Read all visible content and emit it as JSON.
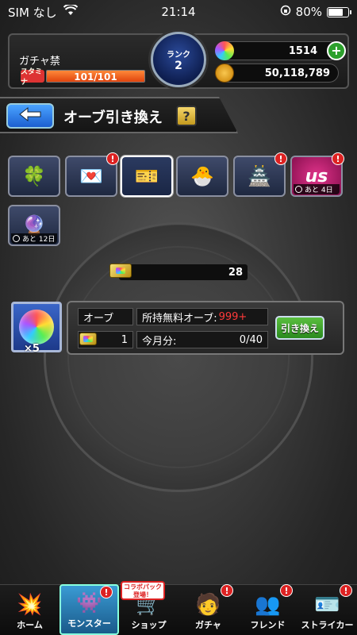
{
  "status_bar": {
    "carrier": "SIM なし",
    "time": "21:14",
    "battery": "80%",
    "battery_level": 0.8
  },
  "header": {
    "gacha_label": "ガチャ禁",
    "stamina_label": "スタミナ",
    "stamina_text": "101/101",
    "stamina_fraction": 1.0,
    "rank_label": "ランク",
    "rank_value": "2",
    "orbs": "1514",
    "gold": "50,118,789",
    "plus_label": "+"
  },
  "title": {
    "text": "オーブ引き換え",
    "help": "?"
  },
  "tiles": [
    {
      "icon": "clover-hat-icon",
      "glyph": "🍀",
      "alert": "",
      "timer": ""
    },
    {
      "icon": "heart-card-icon",
      "glyph": "💌",
      "alert": "!",
      "timer": ""
    },
    {
      "icon": "orb-ticket-icon",
      "glyph": "🎫",
      "alert": "",
      "timer": "",
      "selected": true
    },
    {
      "icon": "yellow-monster-icon",
      "glyph": "🐣",
      "alert": "",
      "timer": ""
    },
    {
      "icon": "castle-box-icon",
      "glyph": "🏯",
      "alert": "!",
      "timer": ""
    },
    {
      "icon": "us-logo-icon",
      "glyph": "us",
      "alert": "!",
      "timer": "あと 4日"
    },
    {
      "icon": "orb-trade-icon",
      "glyph": "🔮",
      "alert": "",
      "timer": "あと 12日"
    }
  ],
  "ticket": {
    "count": "28"
  },
  "exchange": {
    "orb_multiplier": "×5",
    "orb_label": "オーブ",
    "ticket_cost": "1",
    "free_orb_label": "所持無料オーブ:",
    "free_orb_value": "999+",
    "monthly_label": "今月分:",
    "monthly_value": "0/40",
    "button_label": "引き換え"
  },
  "bottom_nav": [
    {
      "label": "ホーム",
      "icon": "home-burst-icon",
      "glyph": "💥",
      "alert": "",
      "active": false
    },
    {
      "label": "モンスター",
      "icon": "monster-icon",
      "glyph": "👾",
      "alert": "!",
      "active": true
    },
    {
      "label": "ショップ",
      "icon": "cart-icon",
      "glyph": "🛒",
      "alert": "",
      "active": false,
      "tag": "コラボパック 登場！"
    },
    {
      "label": "ガチャ",
      "icon": "gacha-character-icon",
      "glyph": "🧑",
      "alert": "!",
      "active": false
    },
    {
      "label": "フレンド",
      "icon": "friends-icon",
      "glyph": "👥",
      "alert": "!",
      "active": false
    },
    {
      "label": "ストライカー",
      "icon": "striker-card-icon",
      "glyph": "🪪",
      "alert": "!",
      "active": false
    }
  ],
  "colors": {
    "accent_blue": "#1c5fd1",
    "stamina_orange": "#e0440d",
    "exchange_green": "#2a8a1e",
    "alert_red": "#d22"
  }
}
